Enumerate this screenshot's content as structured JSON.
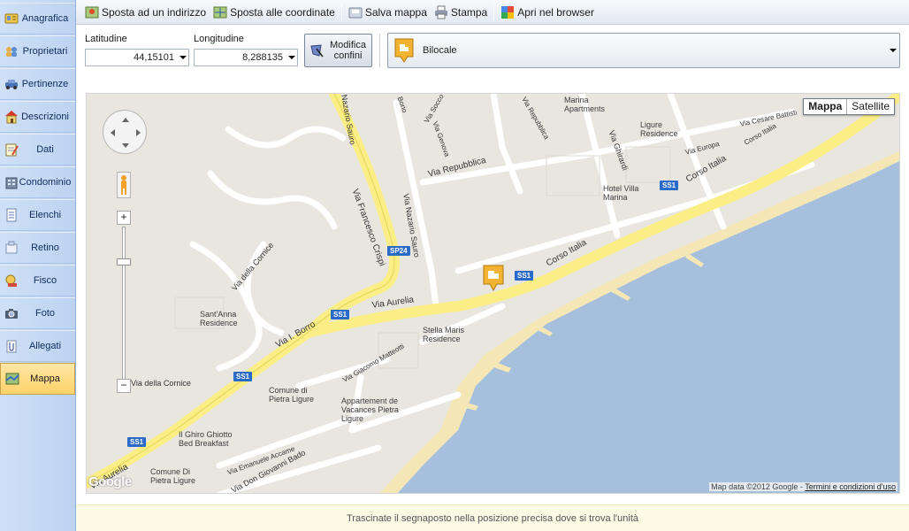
{
  "sidebar": {
    "items": [
      {
        "label": "Anagrafica",
        "icon": "id-card-icon"
      },
      {
        "label": "Proprietari",
        "icon": "people-icon"
      },
      {
        "label": "Pertinenze",
        "icon": "car-icon"
      },
      {
        "label": "Descrizioni",
        "icon": "house-icon"
      },
      {
        "label": "Dati",
        "icon": "notepad-icon"
      },
      {
        "label": "Condominio",
        "icon": "building-icon"
      },
      {
        "label": "Elenchi",
        "icon": "list-icon"
      },
      {
        "label": "Retino",
        "icon": "sticky-note-icon"
      },
      {
        "label": "Fisco",
        "icon": "tax-icon"
      },
      {
        "label": "Foto",
        "icon": "camera-icon"
      },
      {
        "label": "Allegati",
        "icon": "attachment-icon"
      },
      {
        "label": "Mappa",
        "icon": "map-icon"
      }
    ],
    "active": "Mappa"
  },
  "toolbar": {
    "sposta_indirizzo": "Sposta ad un indirizzo",
    "sposta_coordinate": "Sposta alle coordinate",
    "salva_mappa": "Salva mappa",
    "stampa": "Stampa",
    "apri_browser": "Apri nel browser"
  },
  "coords": {
    "lat_label": "Latitudine",
    "lat_value": "44,15101",
    "lon_label": "Longitudine",
    "lon_value": "8,288135"
  },
  "modifica_confini": {
    "line1": "Modifica",
    "line2": "confini"
  },
  "tipo": {
    "selected": "Bilocale"
  },
  "map": {
    "type_map": "Mappa",
    "type_satellite": "Satellite",
    "attribution": "Map data ©2012 Google - ",
    "terms": "Termini e condizioni d'uso",
    "logo": "Google",
    "zoom_in": "+",
    "zoom_out": "−",
    "colors": {
      "sea": "#a5bfdd",
      "land": "#e9e6e0",
      "road_major": "#fbee86",
      "road_minor": "#ffffff",
      "beach": "#f4e7b5",
      "shield": "#2a6bc9"
    },
    "labels": {
      "via_francesco_crispi": "Via Francesco Crispi",
      "via_nazario_sauro": "Via Nazario Sauro",
      "via_nazario_sauro_top": "Nazario Sauro",
      "via_repubblica": "Via Repubblica",
      "via_della_cornice": "Via della Cornice",
      "via_della_cornice_2": "Via della Cornice",
      "via_aurelia": "Via Aurelia",
      "via_aurelia_2": "Via Aurelia",
      "via_i_borro": "Via I. Borro",
      "corso_italia": "Corso Italia",
      "corso_italia_2": "Corso Italia",
      "corso_italia_3": "Corso Italia",
      "via_genova": "Via Genova",
      "via_soccorso": "Via Socco",
      "via_borio": "Borio",
      "via_repubblica_2": "Via Repubblica",
      "via_ghirardi": "Via Ghirardi",
      "via_europa": "Via Europa",
      "via_cesare_battisti": "Via Cesare Battisti",
      "via_giacomo_matteotti": "Via Giacomo Matteotti",
      "via_emanuele_accame": "Via Emanuele Accame",
      "via_don_giovanni_bado": "Via Don Giovanni Bado",
      "via_delle": "Via delle",
      "marina_apartments": "Marina Apartments",
      "ligure_residence": "Ligure Residence",
      "hotel_villa_marina": "Hotel Villa Marina",
      "santanna_residence": "Sant'Anna Residence",
      "stella_maris_residence": "Stella Maris Residence",
      "comune_di_pietra_ligure": "Comune di Pietra Ligure",
      "appartement_de_vacances": "Appartement de Vacances Pietra Ligure",
      "il_ghiro_ghiotto": "Il Ghiro Ghiotto Bed Breakfast",
      "comune_di_pietra_ligure_2": "Comune Di Pietra Ligure",
      "shield_sp24": "SP24",
      "shield_ss1": "SS1"
    }
  },
  "hint": "Trascinate il segnaposto nella posizione precisa dove si trova l'unità"
}
